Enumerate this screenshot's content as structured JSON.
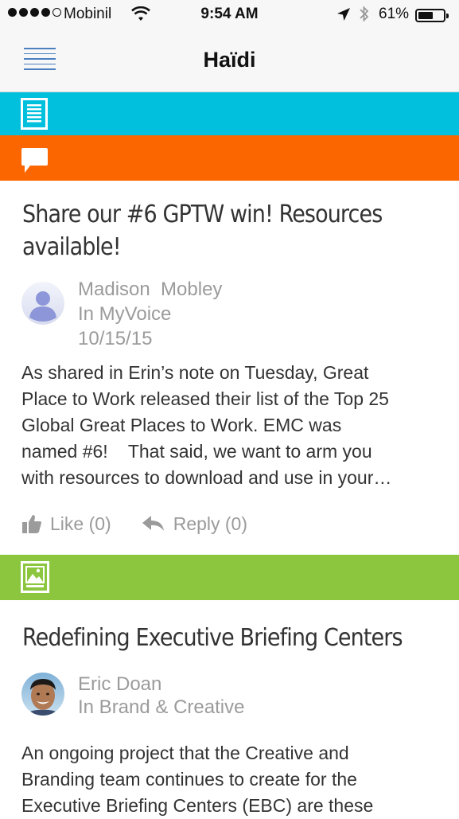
{
  "status_bar": {
    "carrier": "Mobinil",
    "time": "9:54 AM",
    "battery": "61%",
    "battery_level": 0.61
  },
  "nav": {
    "title": "Haïdi",
    "menu_icon": "hamburger-menu-icon"
  },
  "bands": [
    {
      "color": "#00c0de",
      "icon": "document-icon"
    },
    {
      "color": "#fb6600",
      "icon": "chat-bubble-icon"
    },
    {
      "color": "#8cc63f",
      "icon": "image-icon"
    }
  ],
  "posts": [
    {
      "title_line1": "Share our #6 GPTW win! Resources",
      "title_line2": "available!",
      "author": "Madison  Mobley",
      "community": "In MyVoice",
      "date": "10/15/15",
      "body": [
        "As shared in Erin’s note on Tuesday, Great",
        "Place to Work released their list of the Top 25",
        "Global Great Places to Work. EMC was",
        "named #6!    That said, we want to arm you",
        "with resources to download and use in your…"
      ],
      "like_label": "Like (0)",
      "reply_label": "Reply (0)"
    },
    {
      "title_line1": "Redefining Executive Briefing Centers",
      "author": "Eric Doan",
      "community": "In Brand & Creative",
      "body": [
        "An ongoing project that the Creative and",
        "Branding team continues to create for the",
        "Executive Briefing Centers (EBC) are these"
      ]
    }
  ]
}
